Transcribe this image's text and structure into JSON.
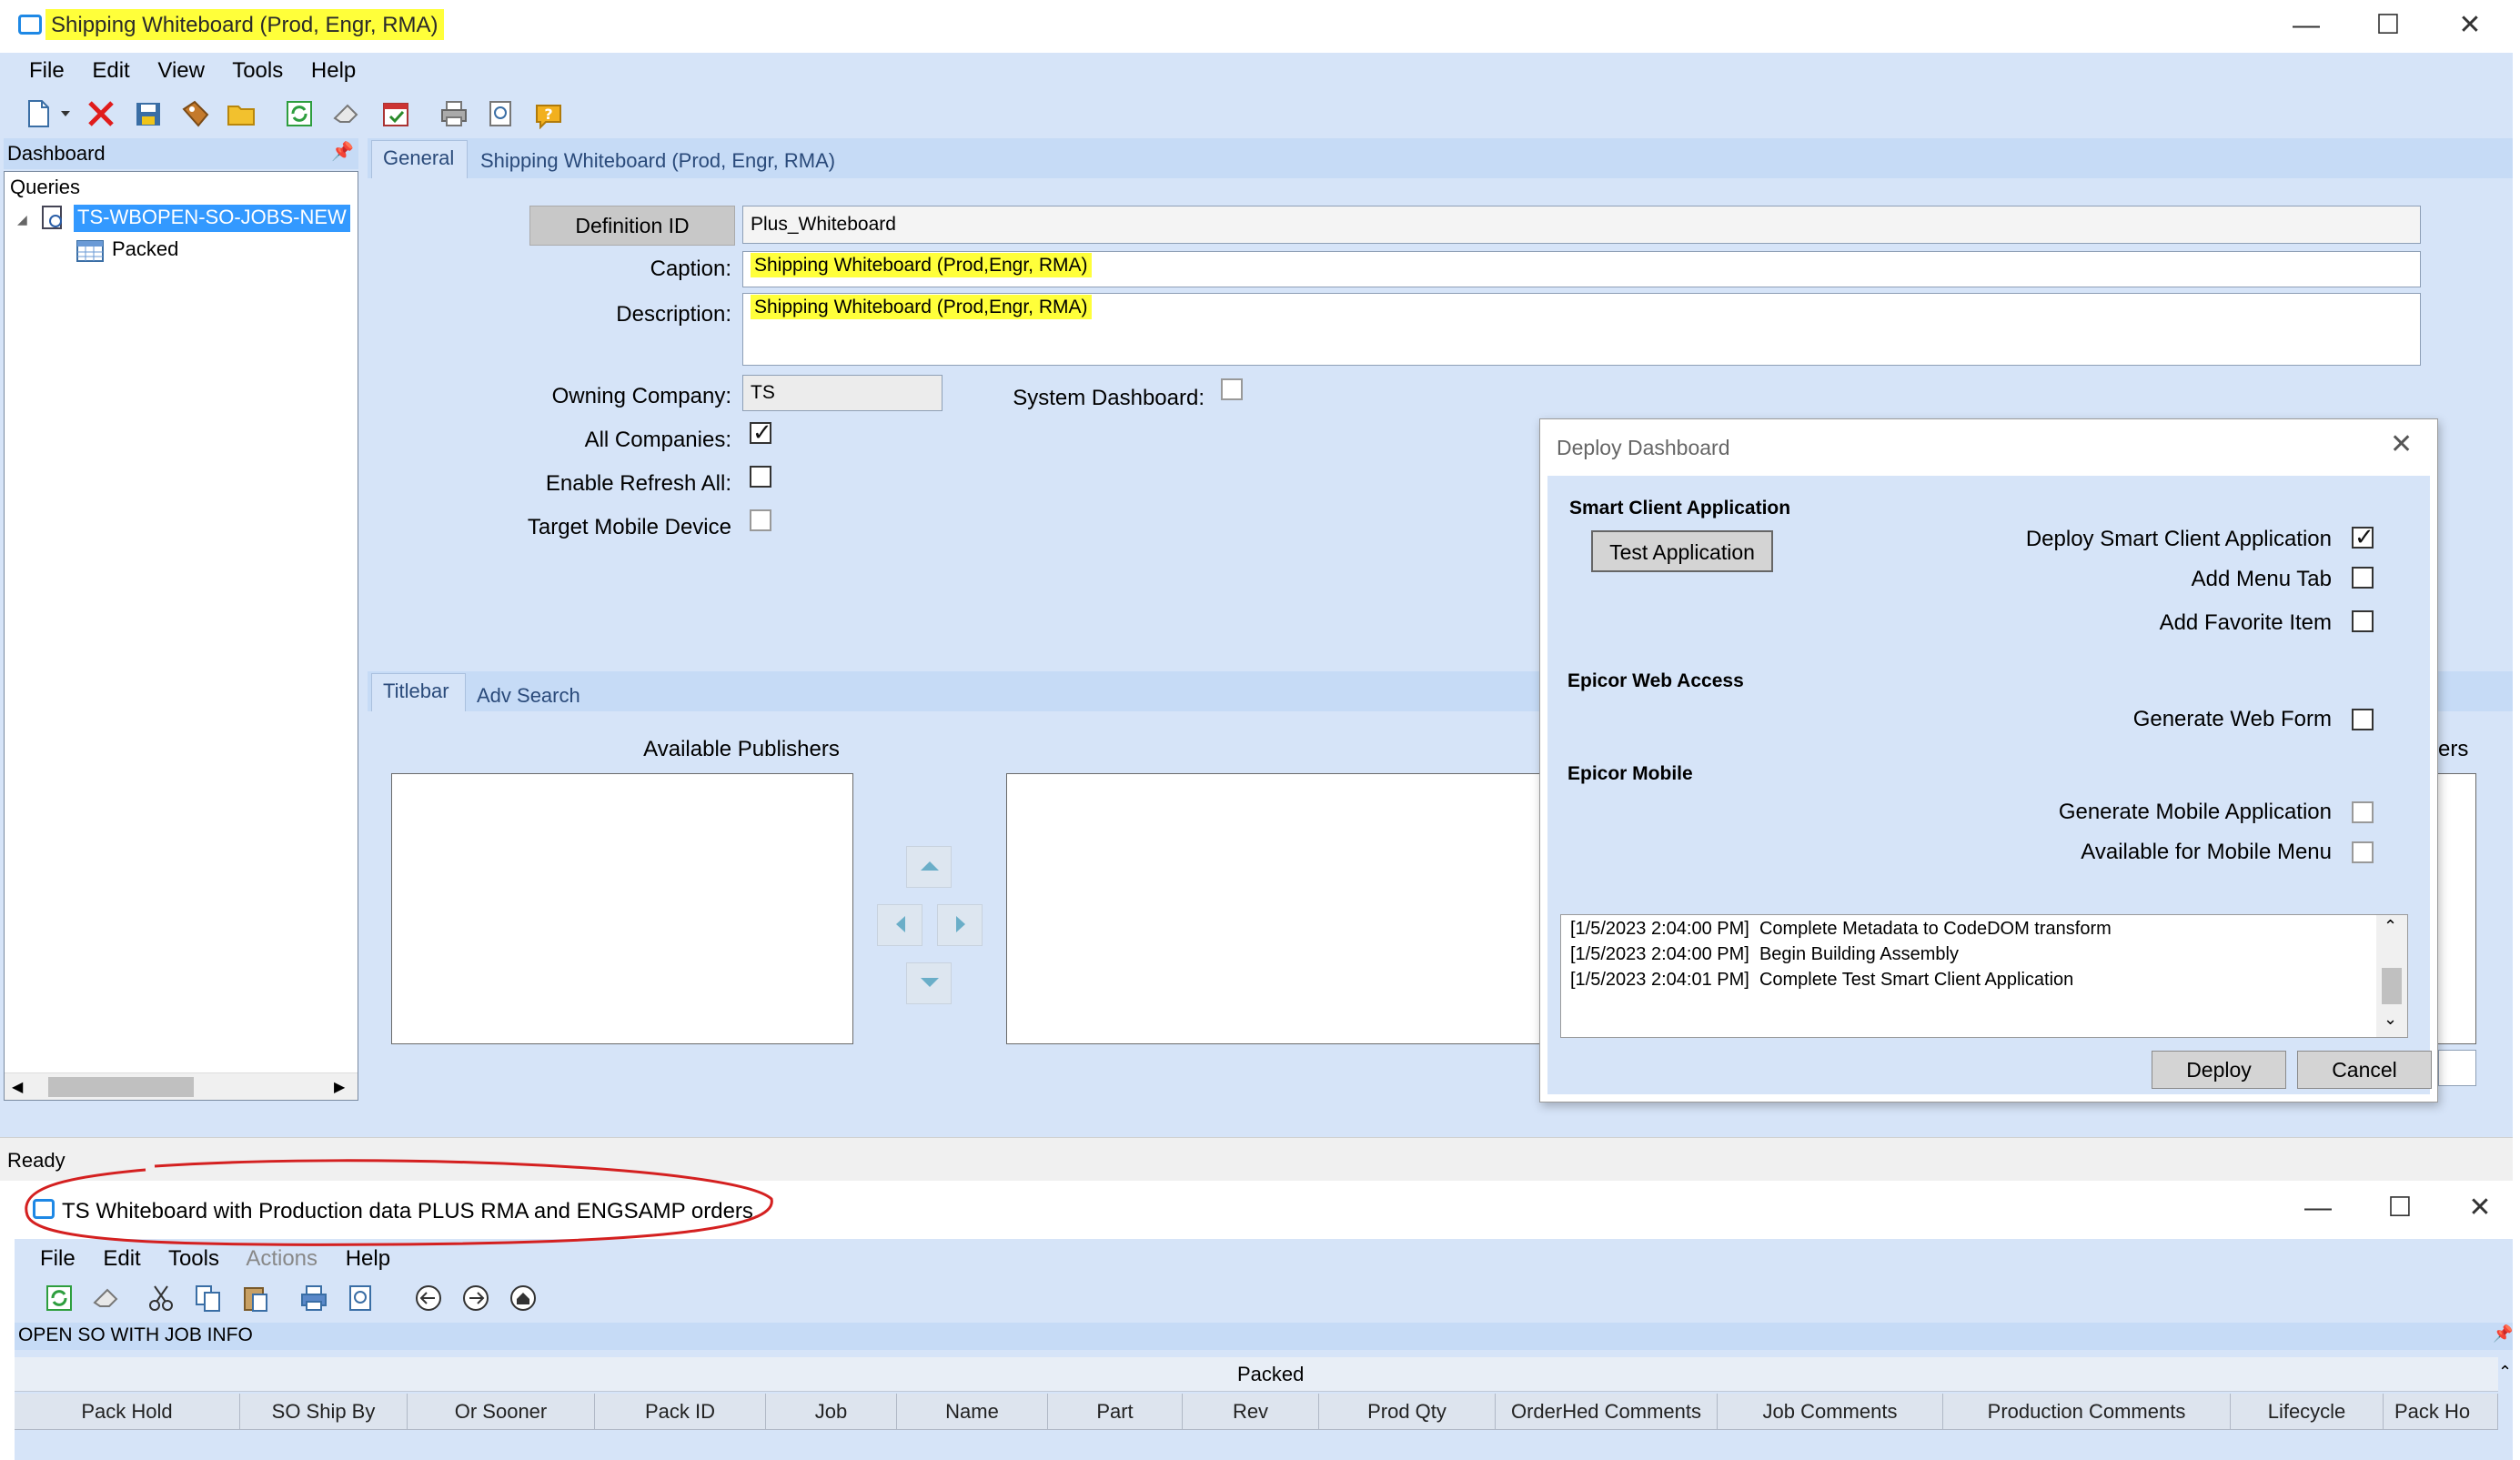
{
  "window1": {
    "title": "Shipping Whiteboard (Prod, Engr, RMA)",
    "menu": [
      "File",
      "Edit",
      "View",
      "Tools",
      "Help"
    ],
    "toolbar_icons": [
      "new-icon",
      "delete-icon",
      "save-icon",
      "tag-icon",
      "folder-icon",
      "refresh-icon",
      "eraser-icon",
      "calendar-icon",
      "print-icon",
      "print-preview-icon",
      "help-icon"
    ],
    "dashboard_panel": {
      "title": "Dashboard",
      "tree_root": "Queries",
      "query": "TS-WBOPEN-SO-JOBS-NEW",
      "child": "Packed"
    },
    "tabs": [
      "General",
      "Shipping Whiteboard (Prod, Engr, RMA)"
    ],
    "form": {
      "definition_id_label": "Definition ID",
      "definition_id": "Plus_Whiteboard",
      "caption_label": "Caption:",
      "caption": "Shipping Whiteboard (Prod,Engr, RMA)",
      "description_label": "Description:",
      "description": "Shipping Whiteboard (Prod,Engr, RMA)",
      "owning_company_label": "Owning Company:",
      "owning_company": "TS",
      "system_dashboard_label": "System Dashboard:",
      "all_companies_label": "All Companies:",
      "enable_refresh_label": "Enable Refresh All:",
      "target_mobile_label": "Target Mobile Device"
    },
    "subtabs": [
      "Titlebar",
      "Adv Search"
    ],
    "available_publishers_label": "Available Publishers",
    "partial_label": "ers",
    "status": "Ready"
  },
  "deploy_dialog": {
    "title": "Deploy Dashboard",
    "smart_client_title": "Smart Client Application",
    "test_button": "Test Application",
    "deploy_smart_client_label": "Deploy Smart Client Application",
    "add_menu_tab_label": "Add Menu Tab",
    "add_favorite_label": "Add Favorite Item",
    "web_access_title": "Epicor Web Access",
    "generate_web_form_label": "Generate Web Form",
    "mobile_title": "Epicor Mobile",
    "generate_mobile_label": "Generate Mobile Application",
    "available_mobile_menu_label": "Available for Mobile Menu",
    "log": [
      {
        "time": "[1/5/2023 2:04:00 PM]",
        "msg": "Complete Metadata to CodeDOM transform"
      },
      {
        "time": "[1/5/2023 2:04:00 PM]",
        "msg": "Begin Building Assembly"
      },
      {
        "time": "[1/5/2023 2:04:01 PM]",
        "msg": "Complete Test Smart Client Application"
      }
    ],
    "deploy_button": "Deploy",
    "cancel_button": "Cancel"
  },
  "window2": {
    "title": "TS Whiteboard with Production data PLUS RMA and ENGSAMP orders.",
    "menu": [
      "File",
      "Edit",
      "Tools",
      "Actions",
      "Help"
    ],
    "section_title": "OPEN SO WITH JOB INFO",
    "grid_caption": "Packed",
    "columns": [
      "Pack Hold",
      "SO Ship By",
      "Or Sooner",
      "Pack ID",
      "Job",
      "Name",
      "Part",
      "Rev",
      "Prod Qty",
      "OrderHed Comments",
      "Job Comments",
      "Production Comments",
      "Lifecycle",
      "Pack Ho"
    ]
  },
  "colors": {
    "highlight": "#ffff3a",
    "panel_blue": "#d6e4f8",
    "selection_blue": "#3399ff",
    "annotation_red": "#d42020"
  }
}
